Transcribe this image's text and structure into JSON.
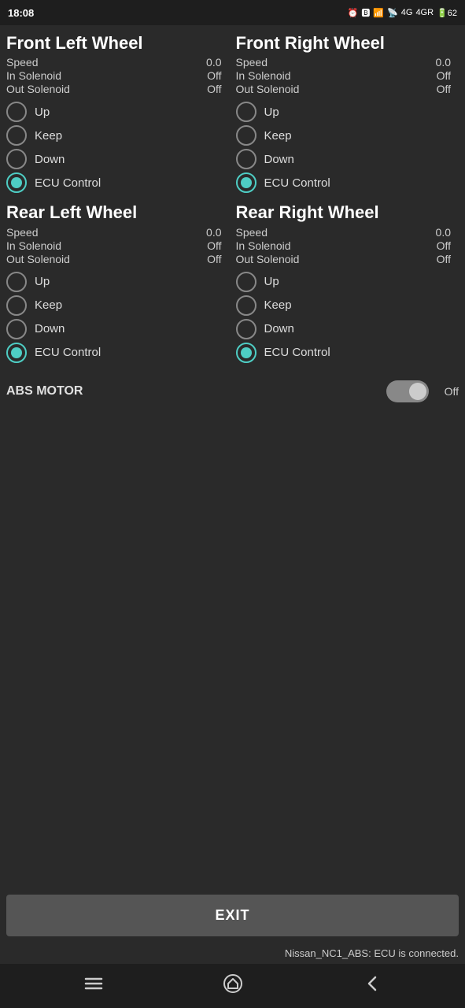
{
  "statusBar": {
    "time": "18:08",
    "rightIcons": [
      "alarm",
      "bluetooth",
      "vibrate",
      "wifi",
      "4G",
      "4GR",
      "battery-62"
    ]
  },
  "wheels": {
    "frontLeft": {
      "title": "Front Left Wheel",
      "speed": {
        "label": "Speed",
        "value": "0.0"
      },
      "inSolenoid": {
        "label": "In Solenoid",
        "value": "Off"
      },
      "outSolenoid": {
        "label": "Out Solenoid",
        "value": "Off"
      },
      "radioOptions": [
        "Up",
        "Keep",
        "Down",
        "ECU Control"
      ],
      "selectedOption": "ECU Control"
    },
    "frontRight": {
      "title": "Front Right Wheel",
      "speed": {
        "label": "Speed",
        "value": "0.0"
      },
      "inSolenoid": {
        "label": "In Solenoid",
        "value": "Off"
      },
      "outSolenoid": {
        "label": "Out Solenoid",
        "value": "Off"
      },
      "radioOptions": [
        "Up",
        "Keep",
        "Down",
        "ECU Control"
      ],
      "selectedOption": "ECU Control"
    },
    "rearLeft": {
      "title": "Rear Left Wheel",
      "speed": {
        "label": "Speed",
        "value": "0.0"
      },
      "inSolenoid": {
        "label": "In Solenoid",
        "value": "Off"
      },
      "outSolenoid": {
        "label": "Out Solenoid",
        "value": "Off"
      },
      "radioOptions": [
        "Up",
        "Keep",
        "Down",
        "ECU Control"
      ],
      "selectedOption": "ECU Control"
    },
    "rearRight": {
      "title": "Rear Right Wheel",
      "speed": {
        "label": "Speed",
        "value": "0.0"
      },
      "inSolenoid": {
        "label": "In Solenoid",
        "value": "Off"
      },
      "outSolenoid": {
        "label": "Out Solenoid",
        "value": "Off"
      },
      "radioOptions": [
        "Up",
        "Keep",
        "Down",
        "ECU Control"
      ],
      "selectedOption": "ECU Control"
    }
  },
  "absMotor": {
    "label": "ABS MOTOR",
    "state": "Off",
    "enabled": false
  },
  "exitButton": {
    "label": "EXIT"
  },
  "statusMessage": "Nissan_NC1_ABS: ECU is connected.",
  "bottomNav": {
    "menu": "☰",
    "home": "home",
    "back": "<"
  }
}
